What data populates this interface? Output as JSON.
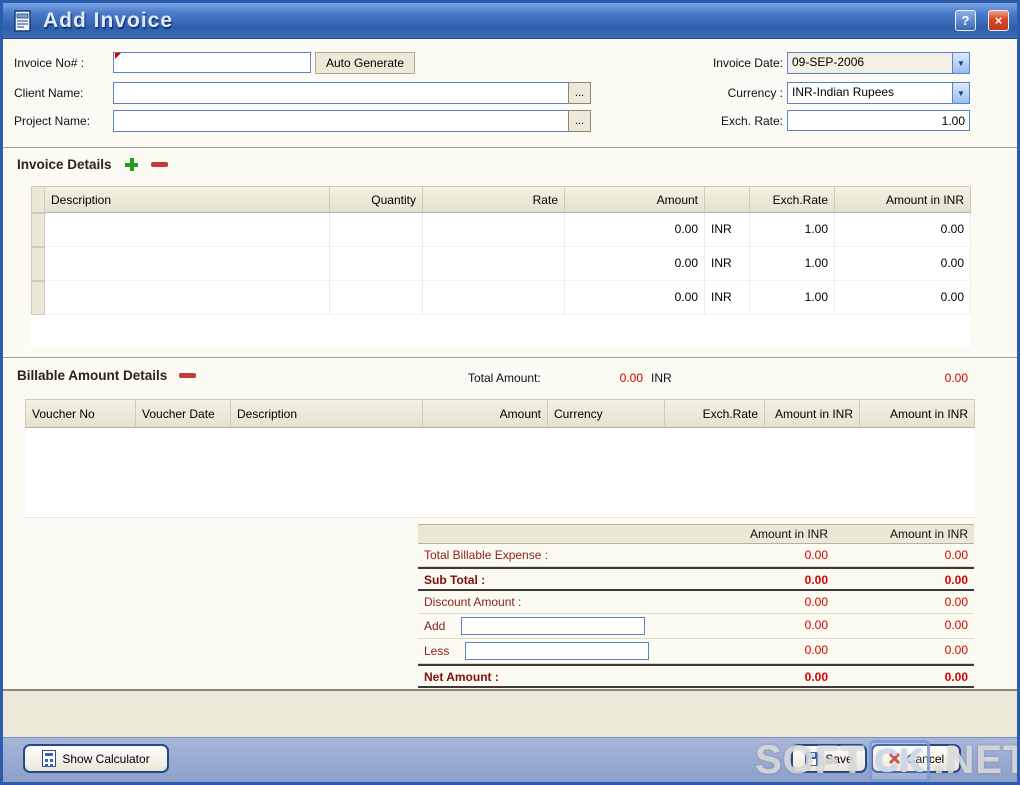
{
  "window": {
    "title": "Add Invoice",
    "help_glyph": "?",
    "close_glyph": "×"
  },
  "form": {
    "invoice_no": {
      "label": "Invoice No# :",
      "value": "",
      "auto_generate_label": "Auto Generate"
    },
    "client_name": {
      "label": "Client Name:",
      "value": "",
      "browse_label": "..."
    },
    "project_name": {
      "label": "Project Name:",
      "value": "",
      "browse_label": "..."
    },
    "invoice_date": {
      "label": "Invoice Date:",
      "value": "09-SEP-2006"
    },
    "currency": {
      "label": "Currency :",
      "value": "INR-Indian Rupees"
    },
    "exch_rate": {
      "label": "Exch. Rate:",
      "value": "1.00"
    }
  },
  "invoice_details": {
    "title": "Invoice Details",
    "columns": [
      "Description",
      "Quantity",
      "Rate",
      "Amount",
      "",
      "Exch.Rate",
      "Amount in INR"
    ],
    "rows": [
      {
        "description": "",
        "quantity": "",
        "rate": "",
        "amount": "0.00",
        "currency": "INR",
        "exch_rate": "1.00",
        "amount_in_inr": "0.00"
      },
      {
        "description": "",
        "quantity": "",
        "rate": "",
        "amount": "0.00",
        "currency": "INR",
        "exch_rate": "1.00",
        "amount_in_inr": "0.00"
      },
      {
        "description": "",
        "quantity": "",
        "rate": "",
        "amount": "0.00",
        "currency": "INR",
        "exch_rate": "1.00",
        "amount_in_inr": "0.00"
      }
    ]
  },
  "billable": {
    "title": "Billable Amount Details",
    "total_amount_label": "Total Amount:",
    "total_amount": "0.00",
    "total_currency": "INR",
    "total_amount_in_inr": "0.00",
    "columns": [
      "Voucher No",
      "Voucher Date",
      "Description",
      "Amount",
      "Currency",
      "Exch.Rate",
      "Amount in INR",
      "Amount in  INR"
    ]
  },
  "summary": {
    "headers": [
      "Amount in INR",
      "Amount in INR"
    ],
    "rows": [
      {
        "label": "Total Billable Expense :",
        "v1": "0.00",
        "v2": "0.00"
      },
      {
        "label": "Sub Total :",
        "v1": "0.00",
        "v2": "0.00"
      },
      {
        "label": "Discount Amount :",
        "v1": "0.00",
        "v2": "0.00"
      },
      {
        "label": "Add",
        "value": "",
        "v1": "0.00",
        "v2": "0.00"
      },
      {
        "label": "Less",
        "value": "",
        "v1": "0.00",
        "v2": "0.00"
      },
      {
        "label": "Net Amount :",
        "v1": "0.00",
        "v2": "0.00"
      }
    ]
  },
  "footer": {
    "show_calculator_label": "Show Calculator",
    "save_label": "Save",
    "cancel_label": "Cancel"
  },
  "watermark": {
    "part1": "SOFT",
    "part2": "CK",
    "part3": ".NET"
  }
}
